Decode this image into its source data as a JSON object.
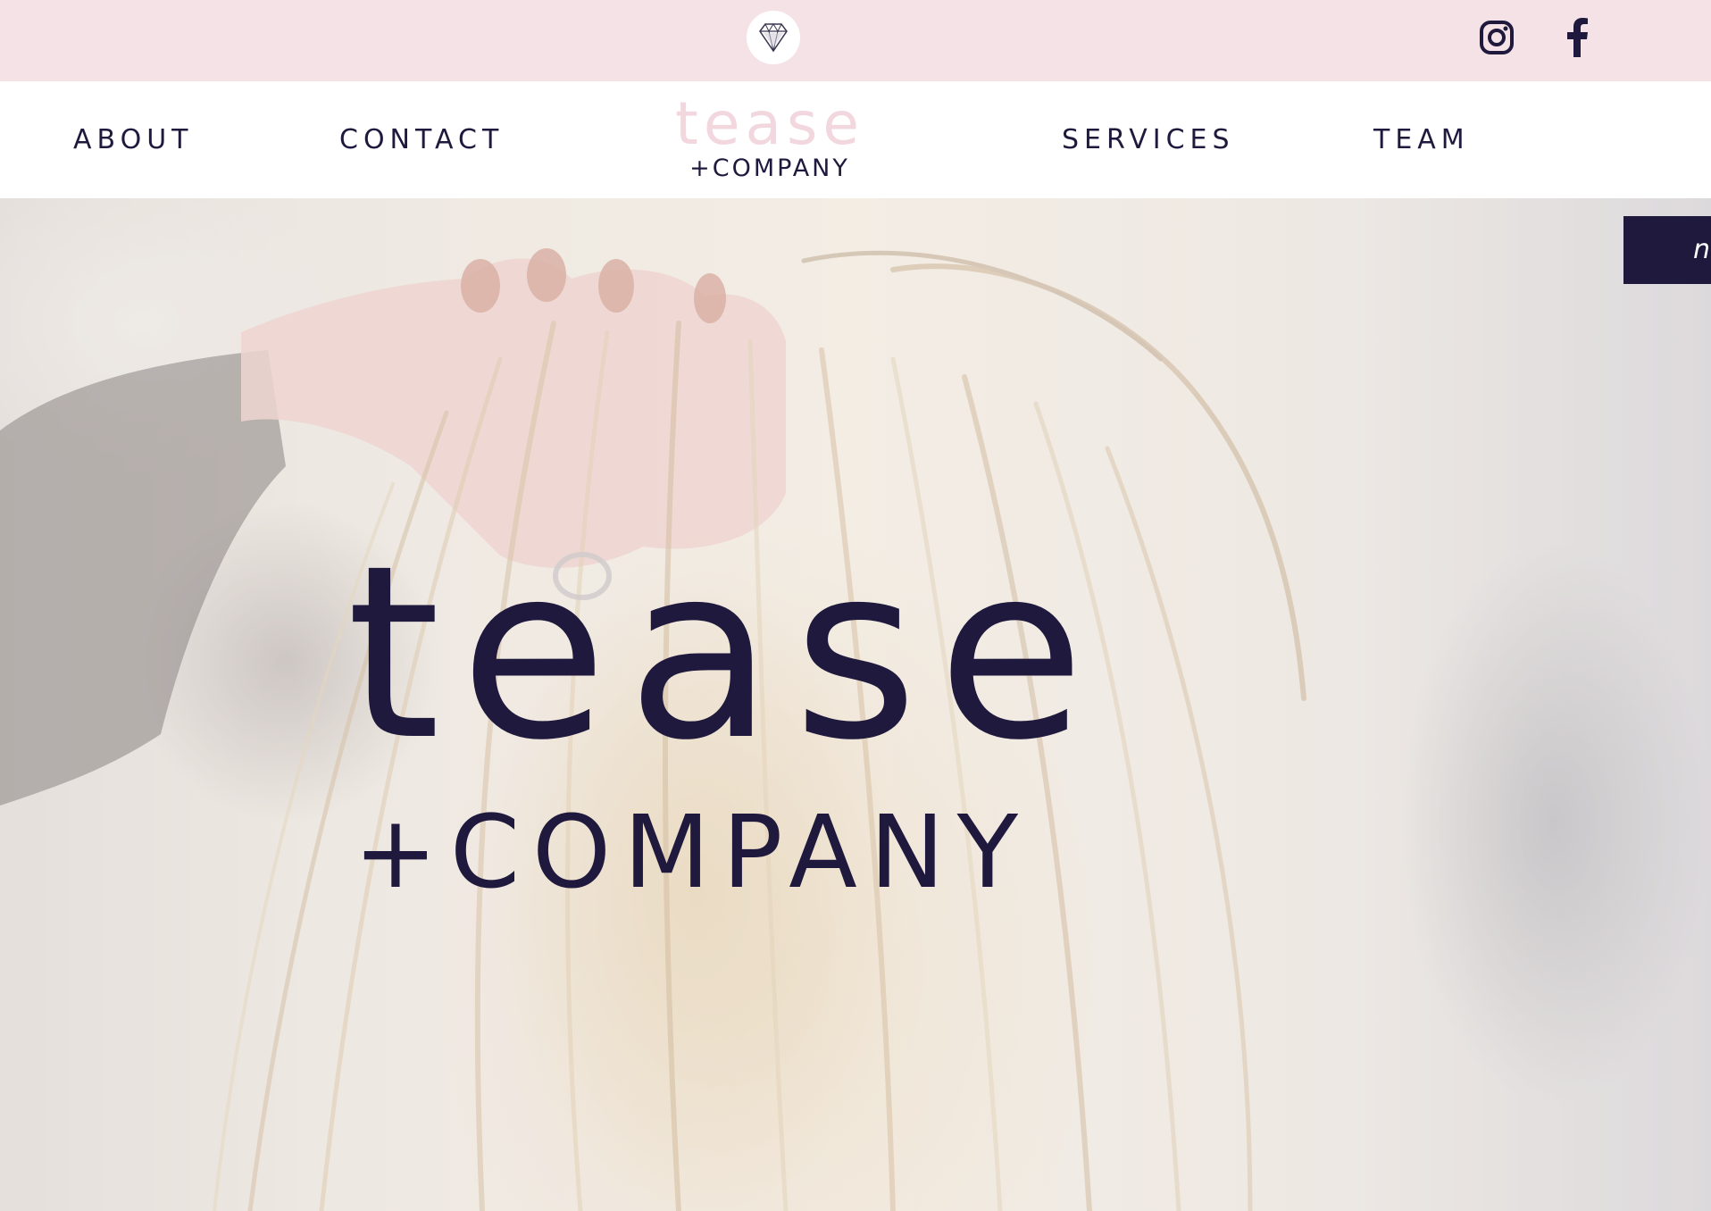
{
  "topbar": {
    "badge_icon": "diamond-gem-icon",
    "social": [
      {
        "name": "instagram",
        "icon": "instagram-icon"
      },
      {
        "name": "facebook",
        "icon": "facebook-icon"
      }
    ]
  },
  "nav": {
    "items": [
      {
        "label": "ABOUT"
      },
      {
        "label": "CONTACT"
      },
      {
        "label": "SERVICES"
      },
      {
        "label": "TEAM"
      }
    ],
    "logo": {
      "word": "tease",
      "sub": "+COMPANY"
    }
  },
  "hero": {
    "logo_word": "tease",
    "logo_sub": "+COMPANY",
    "side_tab_label": "n"
  },
  "colors": {
    "topbar_bg": "#f5e2e6",
    "navy": "#1f1a3d",
    "logo_pink": "#f2d7df",
    "white": "#ffffff"
  }
}
